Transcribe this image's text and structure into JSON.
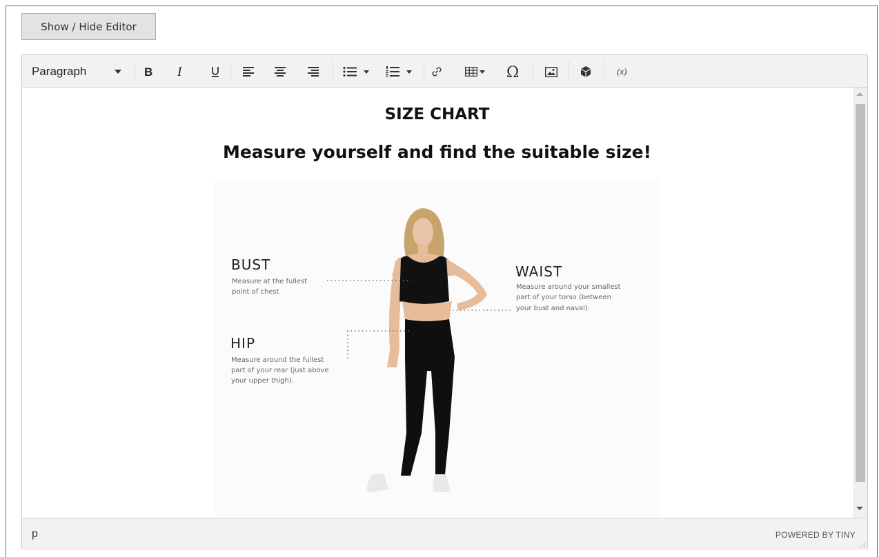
{
  "toggle_button": {
    "label": "Show / Hide Editor"
  },
  "toolbar": {
    "format_select": "Paragraph",
    "items": [
      "bold",
      "italic",
      "underline",
      "align-left",
      "align-center",
      "align-right",
      "bullet-list",
      "numbered-list",
      "link",
      "table",
      "special-character",
      "insert-image",
      "insert-widget",
      "insert-variable"
    ]
  },
  "content": {
    "title": "SIZE CHART",
    "subtitle": "Measure yourself and find the suitable size!",
    "image": {
      "bust_label": "BUST",
      "bust_desc_1": "Measure at the fullest",
      "bust_desc_2": "point of chest",
      "waist_label": "WAIST",
      "waist_desc_1": "Measure around your smallest",
      "waist_desc_2": "part of your torso (between",
      "waist_desc_3": "your bust and naval).",
      "hip_label": "HIP",
      "hip_desc_1": "Measure around the fullest",
      "hip_desc_2": "part of your rear (just above",
      "hip_desc_3": "your upper thigh)."
    }
  },
  "statusbar": {
    "path": "p",
    "branding": "POWERED BY TINY"
  },
  "colors": {
    "frame_border": "#1979c3",
    "toolbar_bg": "#f2f2f2",
    "button_bg": "#e3e3e3",
    "scroll_thumb": "#bdbdbd"
  }
}
